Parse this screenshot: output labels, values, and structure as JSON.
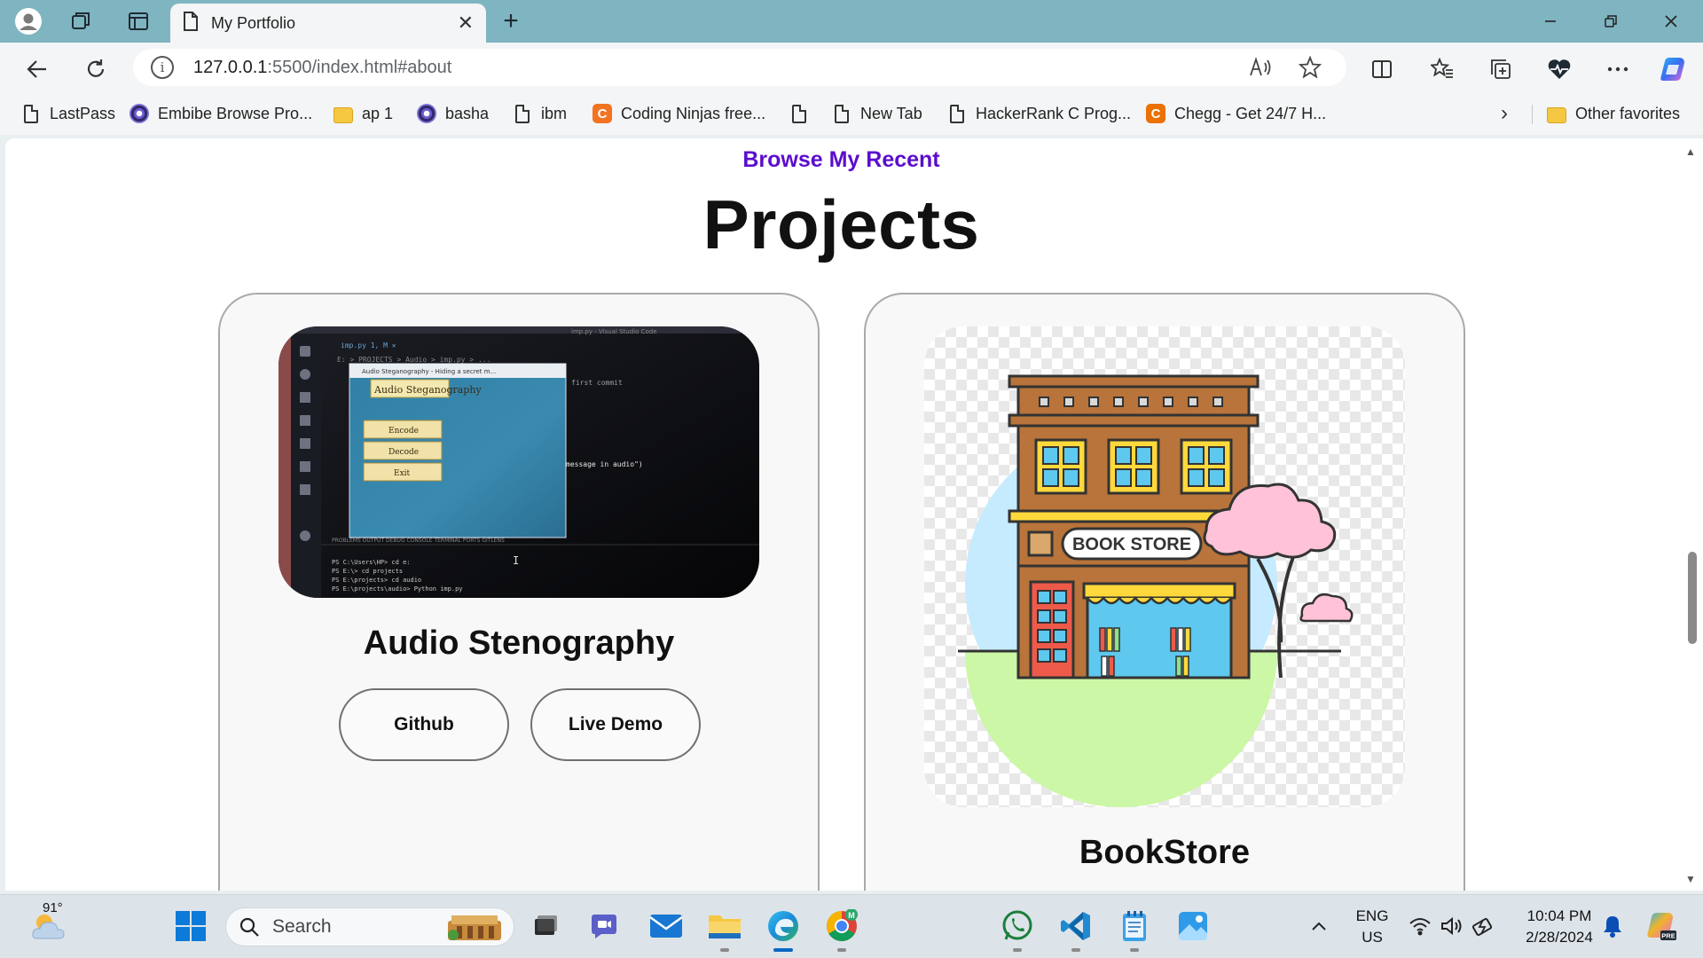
{
  "browser": {
    "tab_title": "My Portfolio",
    "url_host": "127.0.0.1",
    "url_rest": ":5500/index.html#about"
  },
  "favorites": [
    {
      "label": "LastPass",
      "icon": "lastpass-icon"
    },
    {
      "label": "Embibe Browse Pro...",
      "icon": "embibe-icon"
    },
    {
      "label": "ap 1",
      "icon": "folder-icon"
    },
    {
      "label": "basha",
      "icon": "embibe-icon"
    },
    {
      "label": "ibm",
      "icon": "page-icon"
    },
    {
      "label": "Coding Ninjas free...",
      "icon": "coding-ninjas-icon"
    },
    {
      "label": "",
      "icon": "page-icon"
    },
    {
      "label": "New Tab",
      "icon": "page-icon"
    },
    {
      "label": "HackerRank C Prog...",
      "icon": "page-icon"
    },
    {
      "label": "Chegg - Get 24/7 H...",
      "icon": "chegg-icon"
    }
  ],
  "other_favorites": "Other favorites",
  "page": {
    "subtitle": "Browse My Recent",
    "title": "Projects",
    "projects": [
      {
        "name": "Audio Stenography",
        "buttons": [
          "Github",
          "Live Demo"
        ]
      },
      {
        "name": "BookStore"
      }
    ],
    "screenshot_texts": {
      "window_title": "Audio Steganography - Hiding a secret m...",
      "heading": "Audio Steganography",
      "encode": "Encode",
      "decode": "Decode",
      "exit": "Exit",
      "commit": "first commit",
      "code": "message in audio\")",
      "terminal_lines": [
        "PS C:\\Users\\HP> cd e:",
        "PS E:\\> cd projects",
        "PS E:\\projects> cd audio",
        "PS E:\\projects\\audio> Python imp.py"
      ]
    },
    "bookstore_sign": "BOOK STORE"
  },
  "taskbar": {
    "weather": "91°",
    "search_placeholder": "Search",
    "lang_top": "ENG",
    "lang_bottom": "US",
    "time": "10:04 PM",
    "date": "2/28/2024"
  },
  "colors": {
    "accent_purple": "#5b0dce",
    "titlebar": "#7fb4c1",
    "edge_blue": "#0b67c2"
  }
}
